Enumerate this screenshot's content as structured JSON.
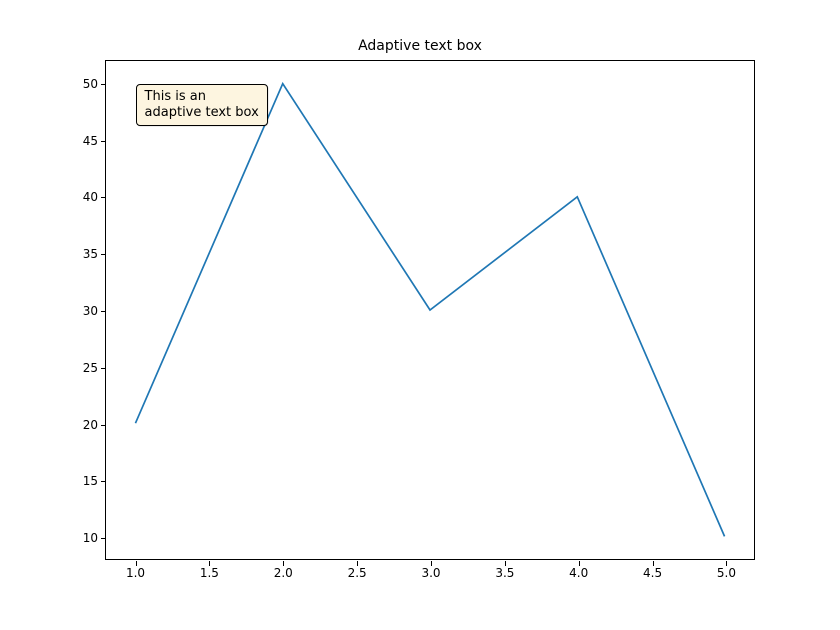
{
  "chart_data": {
    "type": "line",
    "x": [
      1,
      2,
      3,
      4,
      5
    ],
    "values": [
      20,
      50,
      30,
      40,
      10
    ],
    "title": "Adaptive text box",
    "xlabel": "",
    "ylabel": "",
    "xlim": [
      0.8,
      5.2
    ],
    "ylim": [
      8,
      52
    ],
    "xticks": [
      "1.0",
      "1.5",
      "2.0",
      "2.5",
      "3.0",
      "3.5",
      "4.0",
      "4.5",
      "5.0"
    ],
    "yticks": [
      "10",
      "15",
      "20",
      "25",
      "30",
      "35",
      "40",
      "45",
      "50"
    ],
    "annotation": {
      "text_lines": [
        "This is an",
        "adaptive text box"
      ],
      "anchor_x": 1.0,
      "anchor_y": 50,
      "ha": "left",
      "va": "top"
    },
    "line_color": "#1f77b4"
  }
}
